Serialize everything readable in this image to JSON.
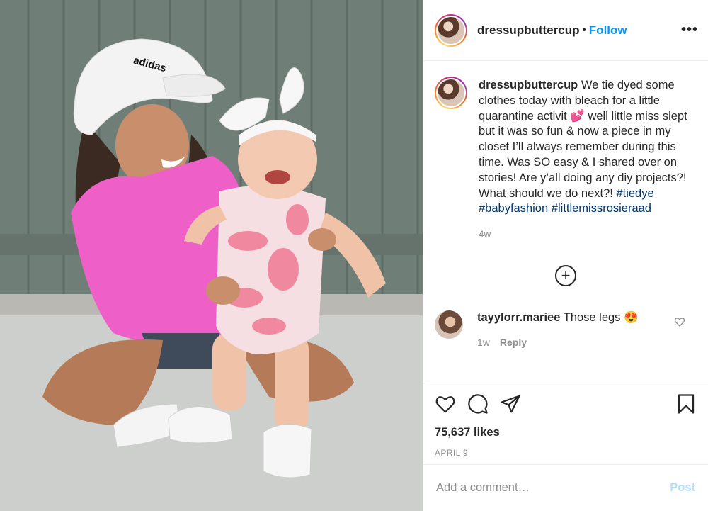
{
  "post": {
    "username": "dressupbuttercup",
    "dot": "•",
    "follow_label": "Follow",
    "more_label": "•••",
    "caption": {
      "username": "dressupbuttercup",
      "text": " We tie dyed some clothes today with bleach for a little quarantine activit 💕  well little miss slept but it was so fun & now a piece in my closet I’ll always remember during this time. Was SO easy & I shared over on stories! Are y’all doing any diy projects?! What should we do next?! ",
      "hashtags": [
        "#tiedye",
        "#babyfashion",
        "#littlemissrosieraad"
      ],
      "age": "4w"
    },
    "load_more_label": "+",
    "comments": [
      {
        "username": "tayylorr.mariee",
        "text": " Those legs 😍",
        "age": "1w",
        "reply_label": "Reply"
      }
    ],
    "likes": "75,637 likes",
    "date": "APRIL 9",
    "comment_placeholder": "Add a comment…",
    "post_label": "Post"
  },
  "photo": {
    "cap_logo_text": "adidas"
  },
  "colors": {
    "accent": "#0095f6",
    "hashtag": "#00376b",
    "muted": "#8e8e8e",
    "post_disabled": "#b2dffc"
  }
}
